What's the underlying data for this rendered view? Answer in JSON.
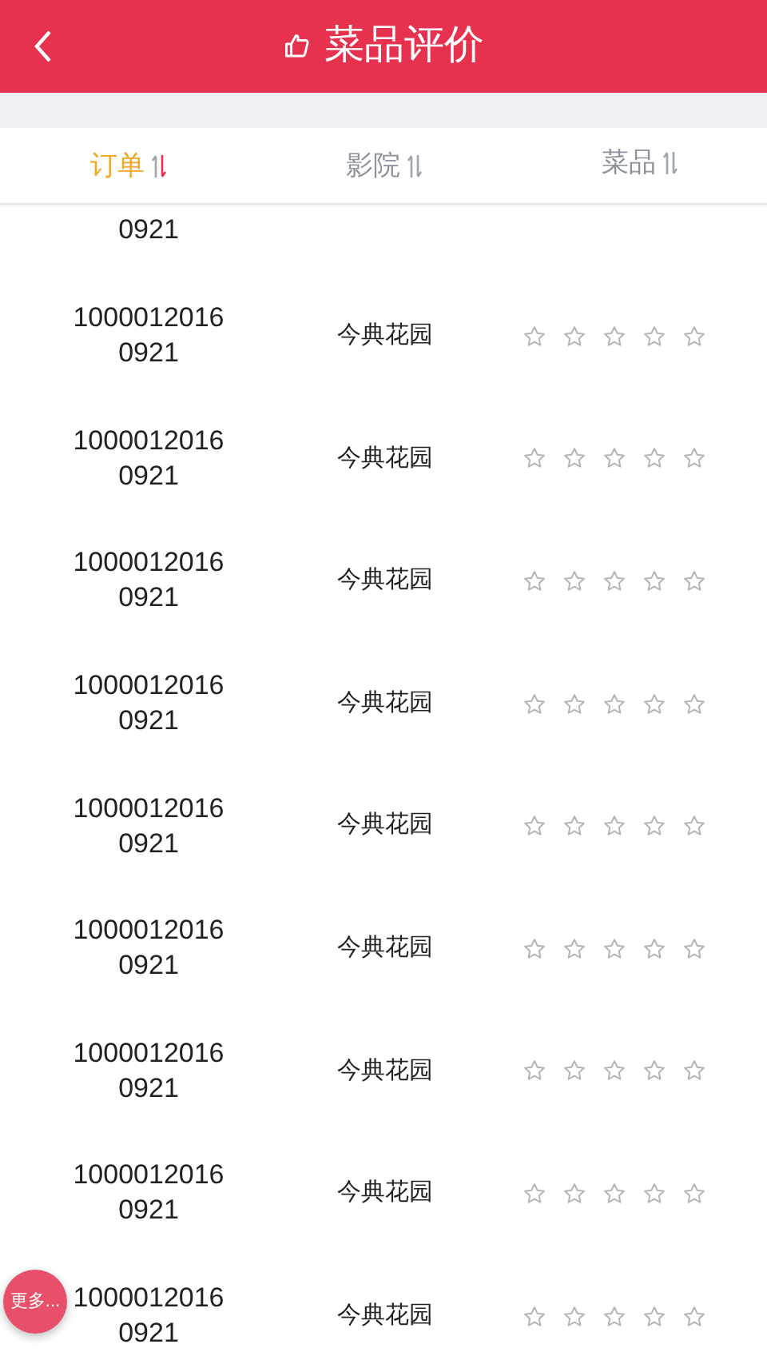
{
  "header": {
    "title": "菜品评价"
  },
  "tabs": [
    {
      "label": "订单",
      "selected": true
    },
    {
      "label": "影院",
      "selected": false
    },
    {
      "label": "菜品",
      "selected": false
    }
  ],
  "rows": [
    {
      "kind": "partial",
      "order": "0921"
    },
    {
      "kind": "full",
      "order": "1000012016\n0921",
      "venue": "今典花园",
      "stars": 0
    },
    {
      "kind": "full",
      "order": "1000012016\n0921",
      "venue": "今典花园",
      "stars": 0
    },
    {
      "kind": "full",
      "order": "1000012016\n0921",
      "venue": "今典花园",
      "stars": 0
    },
    {
      "kind": "full",
      "order": "1000012016\n0921",
      "venue": "今典花园",
      "stars": 0
    },
    {
      "kind": "full",
      "order": "1000012016\n0921",
      "venue": "今典花园",
      "stars": 0
    },
    {
      "kind": "full",
      "order": "1000012016\n0921",
      "venue": "今典花园",
      "stars": 0
    },
    {
      "kind": "full",
      "order": "1000012016\n0921",
      "venue": "今典花园",
      "stars": 0
    },
    {
      "kind": "full",
      "order": "1000012016\n0921",
      "venue": "今典花园",
      "stars": 0
    },
    {
      "kind": "full",
      "order": "1000012016\n0921",
      "venue": "今典花园",
      "stars": 0
    }
  ],
  "more_button": "更多..."
}
